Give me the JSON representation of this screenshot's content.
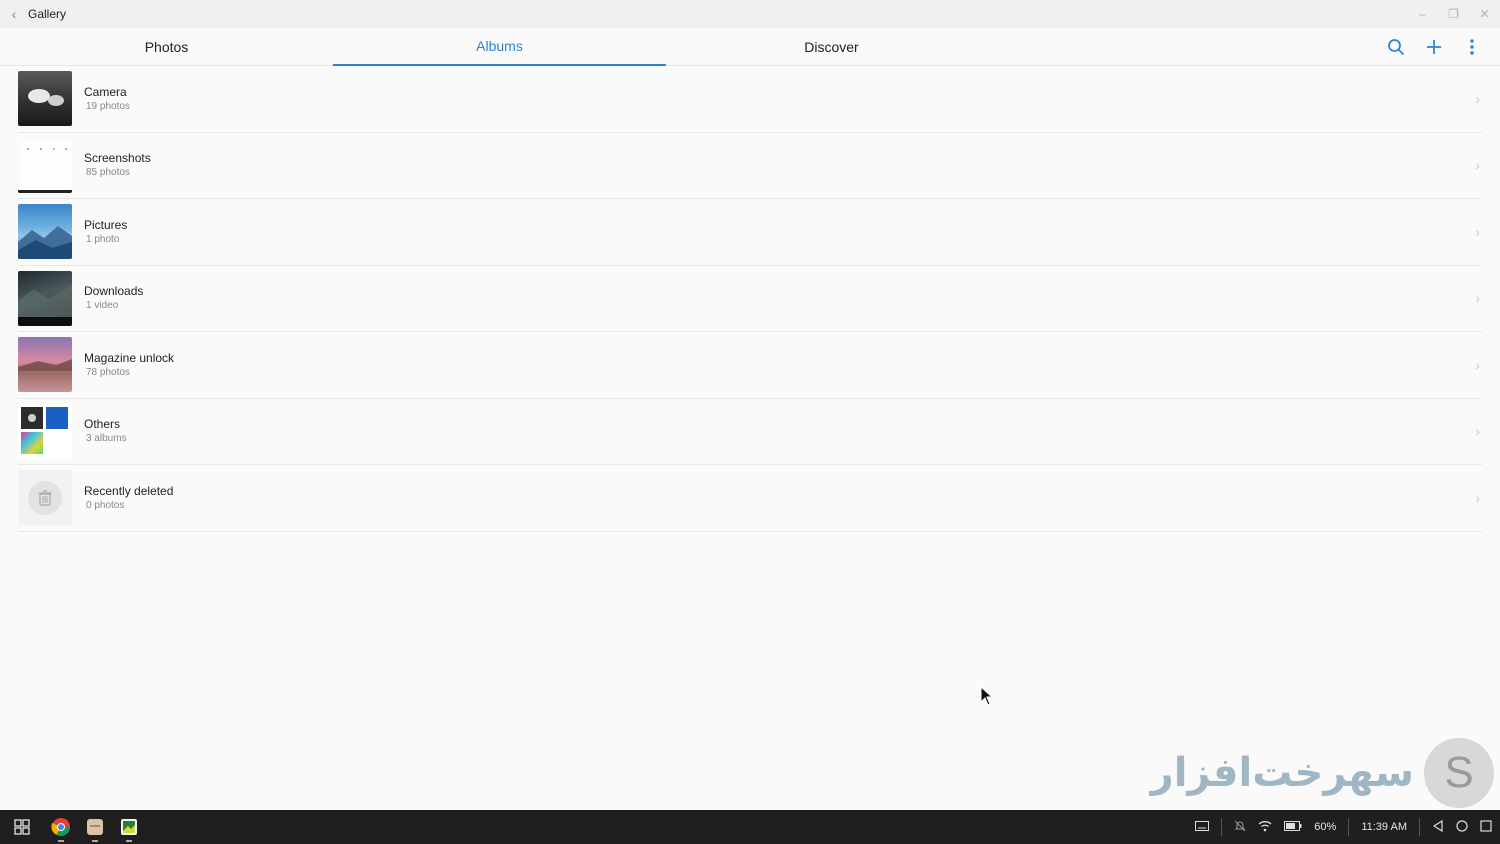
{
  "window": {
    "title": "Gallery"
  },
  "tabs": [
    {
      "label": "Photos",
      "active": false
    },
    {
      "label": "Albums",
      "active": true
    },
    {
      "label": "Discover",
      "active": false
    }
  ],
  "header_actions": [
    "search-icon",
    "add-icon",
    "more-vertical-icon"
  ],
  "albums": [
    {
      "name": "Camera",
      "count": "19 photos"
    },
    {
      "name": "Screenshots",
      "count": "85 photos"
    },
    {
      "name": "Pictures",
      "count": "1 photo"
    },
    {
      "name": "Downloads",
      "count": "1 video"
    },
    {
      "name": "Magazine unlock",
      "count": "78 photos"
    },
    {
      "name": "Others",
      "count": "3 albums"
    },
    {
      "name": "Recently deleted",
      "count": "0 photos"
    }
  ],
  "watermark": {
    "text": "ﺳﻬﺮﺧﺖﺍﻓﺰﺍﺭ"
  },
  "taskbar": {
    "apps": [
      "chrome-icon",
      "files-icon",
      "gallery-icon"
    ],
    "battery": "60%",
    "time": "11:39 AM"
  },
  "colors": {
    "accent": "#2d84d4",
    "taskbar": "#1f1f1f",
    "background": "#fafafa"
  }
}
